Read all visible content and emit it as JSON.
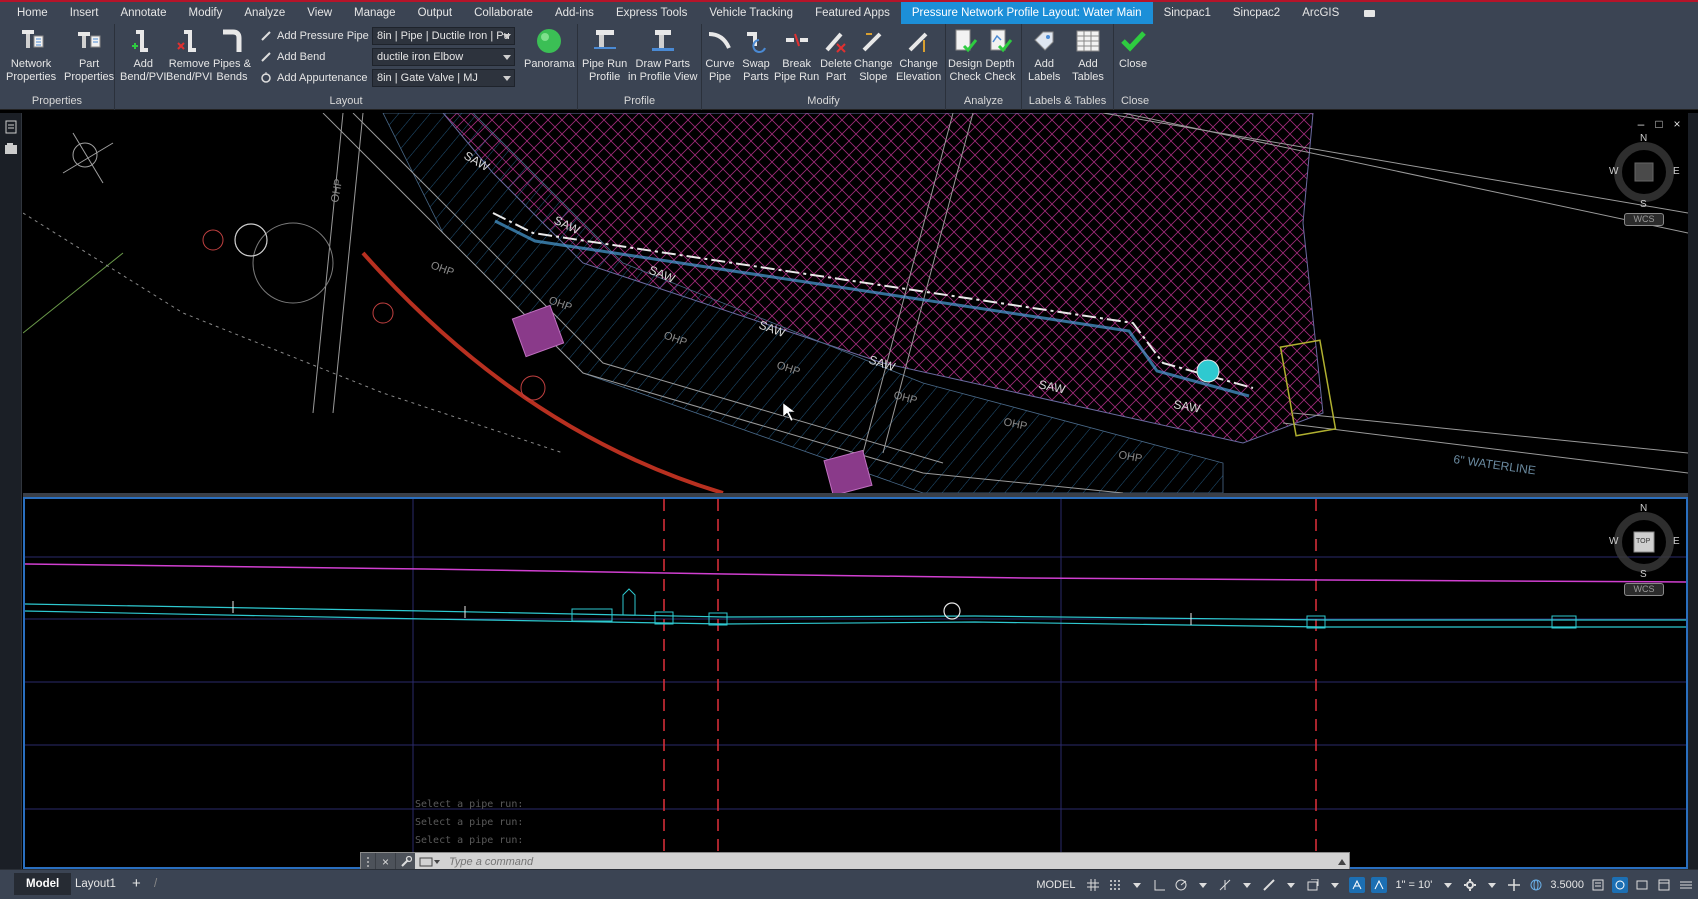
{
  "ribbon_tabs": [
    "Home",
    "Insert",
    "Annotate",
    "Modify",
    "Analyze",
    "View",
    "Manage",
    "Output",
    "Collaborate",
    "Add-ins",
    "Express Tools",
    "Vehicle Tracking",
    "Featured Apps",
    "Pressure Network Profile Layout: Water Main",
    "Sincpac1",
    "Sincpac2",
    "ArcGIS"
  ],
  "active_tab": "Pressure Network Profile Layout: Water Main",
  "panels": {
    "properties": {
      "title": "Properties",
      "network_properties": "Network\nProperties",
      "part_properties": "Part\nProperties"
    },
    "layout": {
      "title": "Layout",
      "add_bend_pvi": "Add\nBend/PVI",
      "remove_bend_pvi": "Remove\nBend/PVI",
      "pipes_bends": "Pipes &\nBends",
      "add_pressure_pipe": "Add Pressure Pipe",
      "add_bend": "Add Bend",
      "add_appurtenance": "Add Appurtenance",
      "pipe_combo": "8in | Pipe | Ductile Iron | Pu",
      "bend_combo": "ductile iron Elbow",
      "appurtenance_combo": "8in | Gate Valve | MJ",
      "panorama": "Panorama"
    },
    "profile": {
      "title": "Profile",
      "pipe_run_profile": "Pipe Run\nProfile",
      "draw_parts": "Draw Parts\nin Profile View"
    },
    "modify": {
      "title": "Modify",
      "curve_pipe": "Curve\nPipe",
      "swap_parts": "Swap\nParts",
      "break_pipe_run": "Break\nPipe Run",
      "delete_part": "Delete\nPart",
      "change_slope": "Change\nSlope",
      "change_elevation": "Change\nElevation"
    },
    "analyze": {
      "title": "Analyze",
      "design_check": "Design\nCheck",
      "depth_check": "Depth\nCheck"
    },
    "labels_tables": {
      "title": "Labels & Tables",
      "add_labels": "Add\nLabels",
      "add_tables": "Add\nTables"
    },
    "close": {
      "title": "Close",
      "close": "Close"
    }
  },
  "plan_view": {
    "labels": [
      "SAW",
      "SAW",
      "SAW",
      "SAW",
      "SAW",
      "SAW",
      "SAW",
      "OHP",
      "OHP",
      "OHP",
      "OHP",
      "OHP",
      "OHP",
      "OHP",
      "OHP",
      "6\" WATERLINE"
    ],
    "viewcube": {
      "n": "N",
      "s": "S",
      "e": "E",
      "w": "W",
      "wcs": "WCS"
    }
  },
  "profile_view": {
    "viewcube": {
      "n": "N",
      "s": "S",
      "e": "E",
      "w": "W",
      "top": "TOP",
      "wcs": "WCS"
    }
  },
  "command": {
    "history": [
      "Select a pipe run:",
      "Select a pipe run:",
      "Select a pipe run:"
    ],
    "placeholder": "Type a command"
  },
  "status": {
    "layout_tabs": [
      "Model",
      "Layout1"
    ],
    "active_layout": "Model",
    "model_label": "MODEL",
    "scale": "1\" = 10'",
    "value": "3.5000"
  },
  "colors": {
    "ribbon_bg": "#3b4453",
    "active_tab": "#1c8fd8",
    "profile_border": "#2a6fbf",
    "water_main": "#2ec9d0",
    "ground": "#d03fd0",
    "station_line": "#e0303a"
  }
}
